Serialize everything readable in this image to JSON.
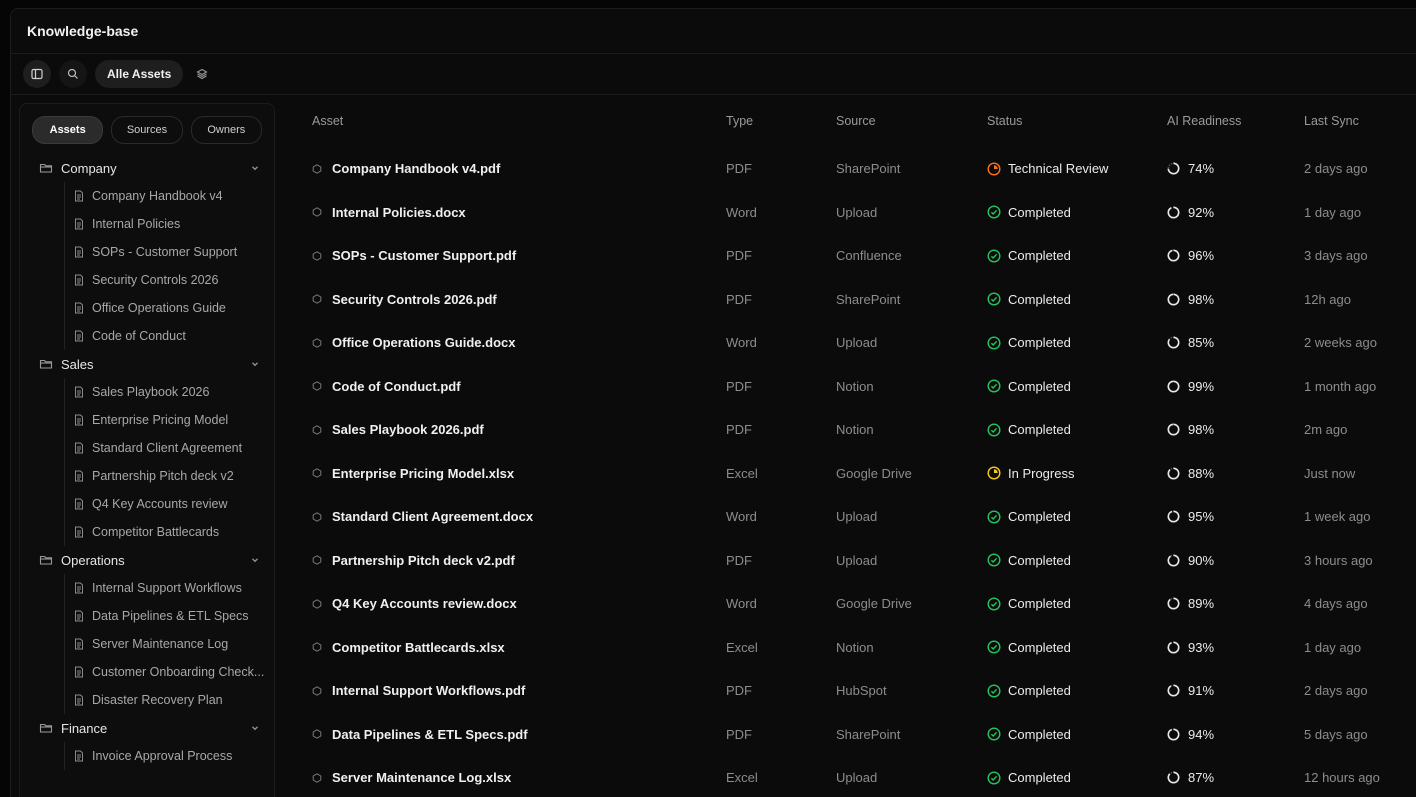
{
  "app": {
    "title": "Knowledge-base"
  },
  "toolbar": {
    "all_assets_label": "Alle Assets"
  },
  "sidebar": {
    "tabs": [
      "Assets",
      "Sources",
      "Owners"
    ],
    "folders": [
      {
        "name": "Company",
        "items": [
          "Company Handbook v4",
          "Internal Policies",
          "SOPs - Customer Support",
          "Security Controls 2026",
          "Office Operations Guide",
          "Code of Conduct"
        ]
      },
      {
        "name": "Sales",
        "items": [
          "Sales Playbook 2026",
          "Enterprise Pricing Model",
          "Standard Client Agreement",
          "Partnership Pitch deck v2",
          "Q4 Key Accounts review",
          "Competitor Battlecards"
        ]
      },
      {
        "name": "Operations",
        "items": [
          "Internal Support Workflows",
          "Data Pipelines & ETL Specs",
          "Server Maintenance Log",
          "Customer Onboarding Check...",
          "Disaster Recovery Plan"
        ]
      },
      {
        "name": "Finance",
        "items": [
          "Invoice Approval Process"
        ]
      }
    ]
  },
  "table": {
    "columns": [
      "Asset",
      "Type",
      "Source",
      "Status",
      "AI Readiness",
      "Last Sync"
    ],
    "rows": [
      {
        "asset": "Company Handbook v4.pdf",
        "type": "PDF",
        "source": "SharePoint",
        "status": "Technical Review",
        "status_kind": "review",
        "ai": "74%",
        "ai_value": 74,
        "sync": "2 days ago"
      },
      {
        "asset": "Internal Policies.docx",
        "type": "Word",
        "source": "Upload",
        "status": "Completed",
        "status_kind": "done",
        "ai": "92%",
        "ai_value": 92,
        "sync": "1 day ago"
      },
      {
        "asset": "SOPs - Customer Support.pdf",
        "type": "PDF",
        "source": "Confluence",
        "status": "Completed",
        "status_kind": "done",
        "ai": "96%",
        "ai_value": 96,
        "sync": "3 days ago"
      },
      {
        "asset": "Security Controls 2026.pdf",
        "type": "PDF",
        "source": "SharePoint",
        "status": "Completed",
        "status_kind": "done",
        "ai": "98%",
        "ai_value": 98,
        "sync": "12h ago"
      },
      {
        "asset": "Office Operations Guide.docx",
        "type": "Word",
        "source": "Upload",
        "status": "Completed",
        "status_kind": "done",
        "ai": "85%",
        "ai_value": 85,
        "sync": "2 weeks ago"
      },
      {
        "asset": "Code of Conduct.pdf",
        "type": "PDF",
        "source": "Notion",
        "status": "Completed",
        "status_kind": "done",
        "ai": "99%",
        "ai_value": 99,
        "sync": "1 month ago"
      },
      {
        "asset": "Sales Playbook 2026.pdf",
        "type": "PDF",
        "source": "Notion",
        "status": "Completed",
        "status_kind": "done",
        "ai": "98%",
        "ai_value": 98,
        "sync": "2m ago"
      },
      {
        "asset": "Enterprise Pricing Model.xlsx",
        "type": "Excel",
        "source": "Google Drive",
        "status": "In Progress",
        "status_kind": "progress",
        "ai": "88%",
        "ai_value": 88,
        "sync": "Just now"
      },
      {
        "asset": "Standard Client Agreement.docx",
        "type": "Word",
        "source": "Upload",
        "status": "Completed",
        "status_kind": "done",
        "ai": "95%",
        "ai_value": 95,
        "sync": "1 week ago"
      },
      {
        "asset": "Partnership Pitch deck v2.pdf",
        "type": "PDF",
        "source": "Upload",
        "status": "Completed",
        "status_kind": "done",
        "ai": "90%",
        "ai_value": 90,
        "sync": "3 hours ago"
      },
      {
        "asset": "Q4 Key Accounts review.docx",
        "type": "Word",
        "source": "Google Drive",
        "status": "Completed",
        "status_kind": "done",
        "ai": "89%",
        "ai_value": 89,
        "sync": "4 days ago"
      },
      {
        "asset": "Competitor Battlecards.xlsx",
        "type": "Excel",
        "source": "Notion",
        "status": "Completed",
        "status_kind": "done",
        "ai": "93%",
        "ai_value": 93,
        "sync": "1 day ago"
      },
      {
        "asset": "Internal Support Workflows.pdf",
        "type": "PDF",
        "source": "HubSpot",
        "status": "Completed",
        "status_kind": "done",
        "ai": "91%",
        "ai_value": 91,
        "sync": "2 days ago"
      },
      {
        "asset": "Data Pipelines & ETL Specs.pdf",
        "type": "PDF",
        "source": "SharePoint",
        "status": "Completed",
        "status_kind": "done",
        "ai": "94%",
        "ai_value": 94,
        "sync": "5 days ago"
      },
      {
        "asset": "Server Maintenance Log.xlsx",
        "type": "Excel",
        "source": "Upload",
        "status": "Completed",
        "status_kind": "done",
        "ai": "87%",
        "ai_value": 87,
        "sync": "12 hours ago"
      }
    ]
  },
  "colors": {
    "completed": "#22c55e",
    "review": "#f97316",
    "progress": "#facc15"
  }
}
